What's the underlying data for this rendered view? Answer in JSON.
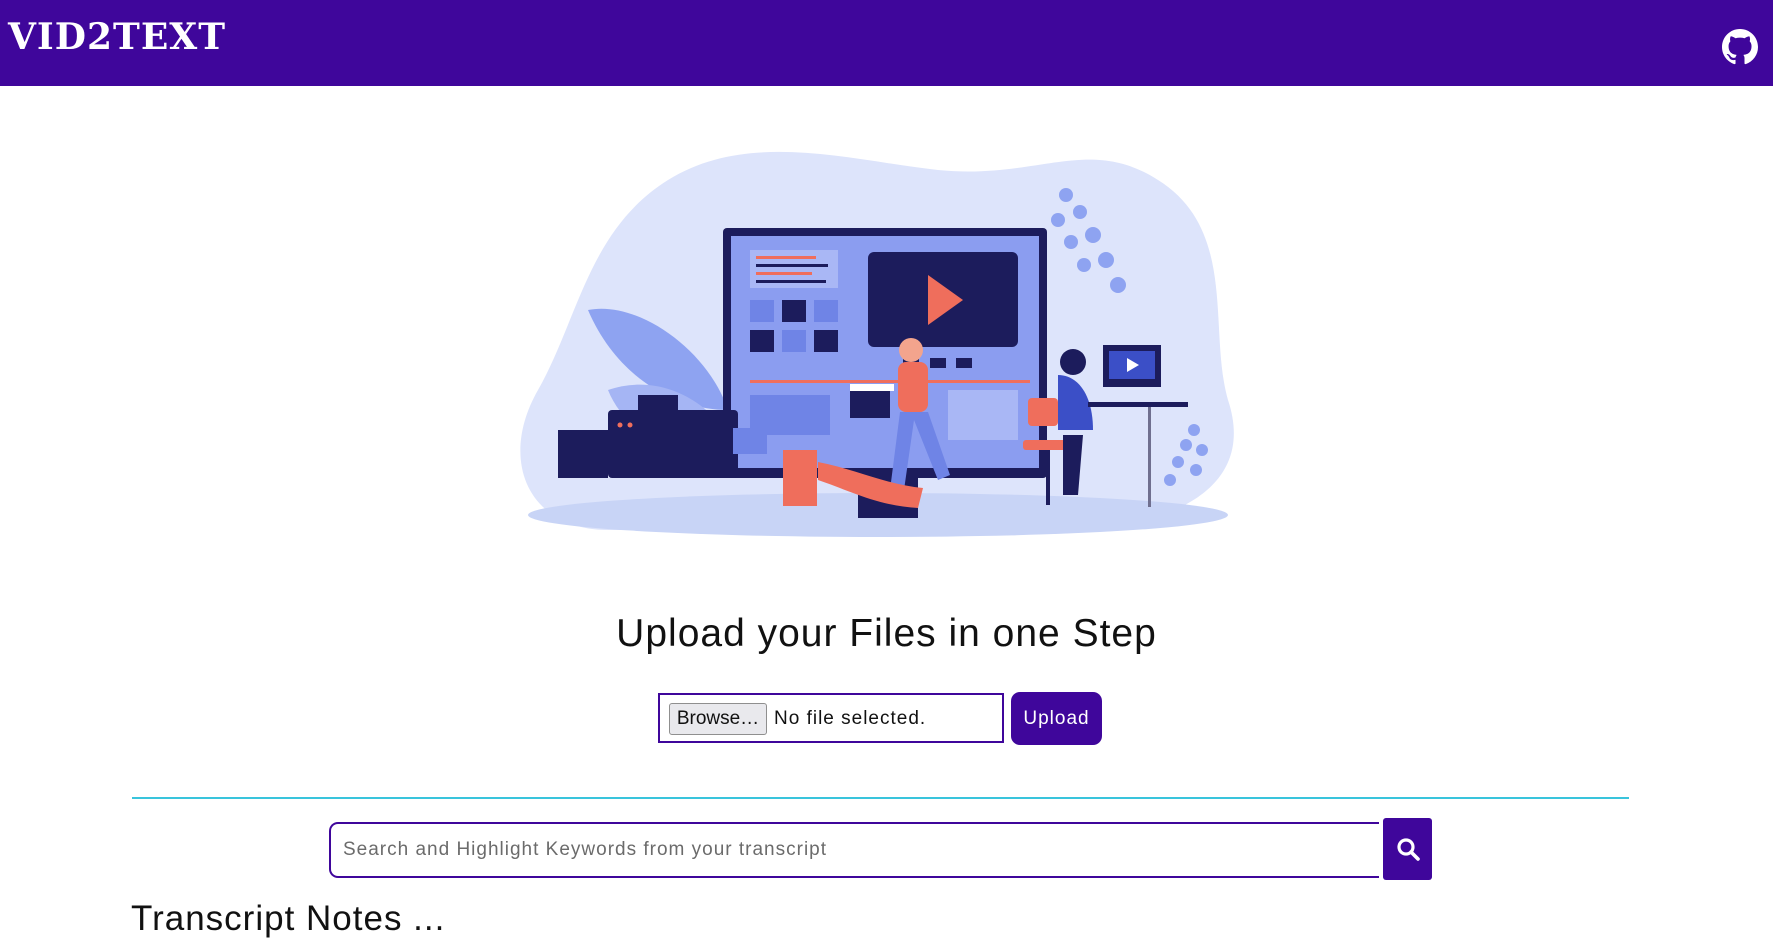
{
  "navbar": {
    "brand": "VID2TEXT",
    "github_icon": "github-icon",
    "background_color": "#3f069b"
  },
  "hero": {
    "image": "video-editing-illustration"
  },
  "upload": {
    "heading": "Upload your Files in one Step",
    "browse_label": "Browse…",
    "file_status": "No file selected.",
    "upload_label": "Upload"
  },
  "search": {
    "placeholder": "Search and Highlight Keywords from your transcript",
    "value": "",
    "icon": "search-icon"
  },
  "notes": {
    "title": "Transcript Notes ..."
  },
  "colors": {
    "accent": "#3f069b",
    "divider": "#39c4dc"
  }
}
